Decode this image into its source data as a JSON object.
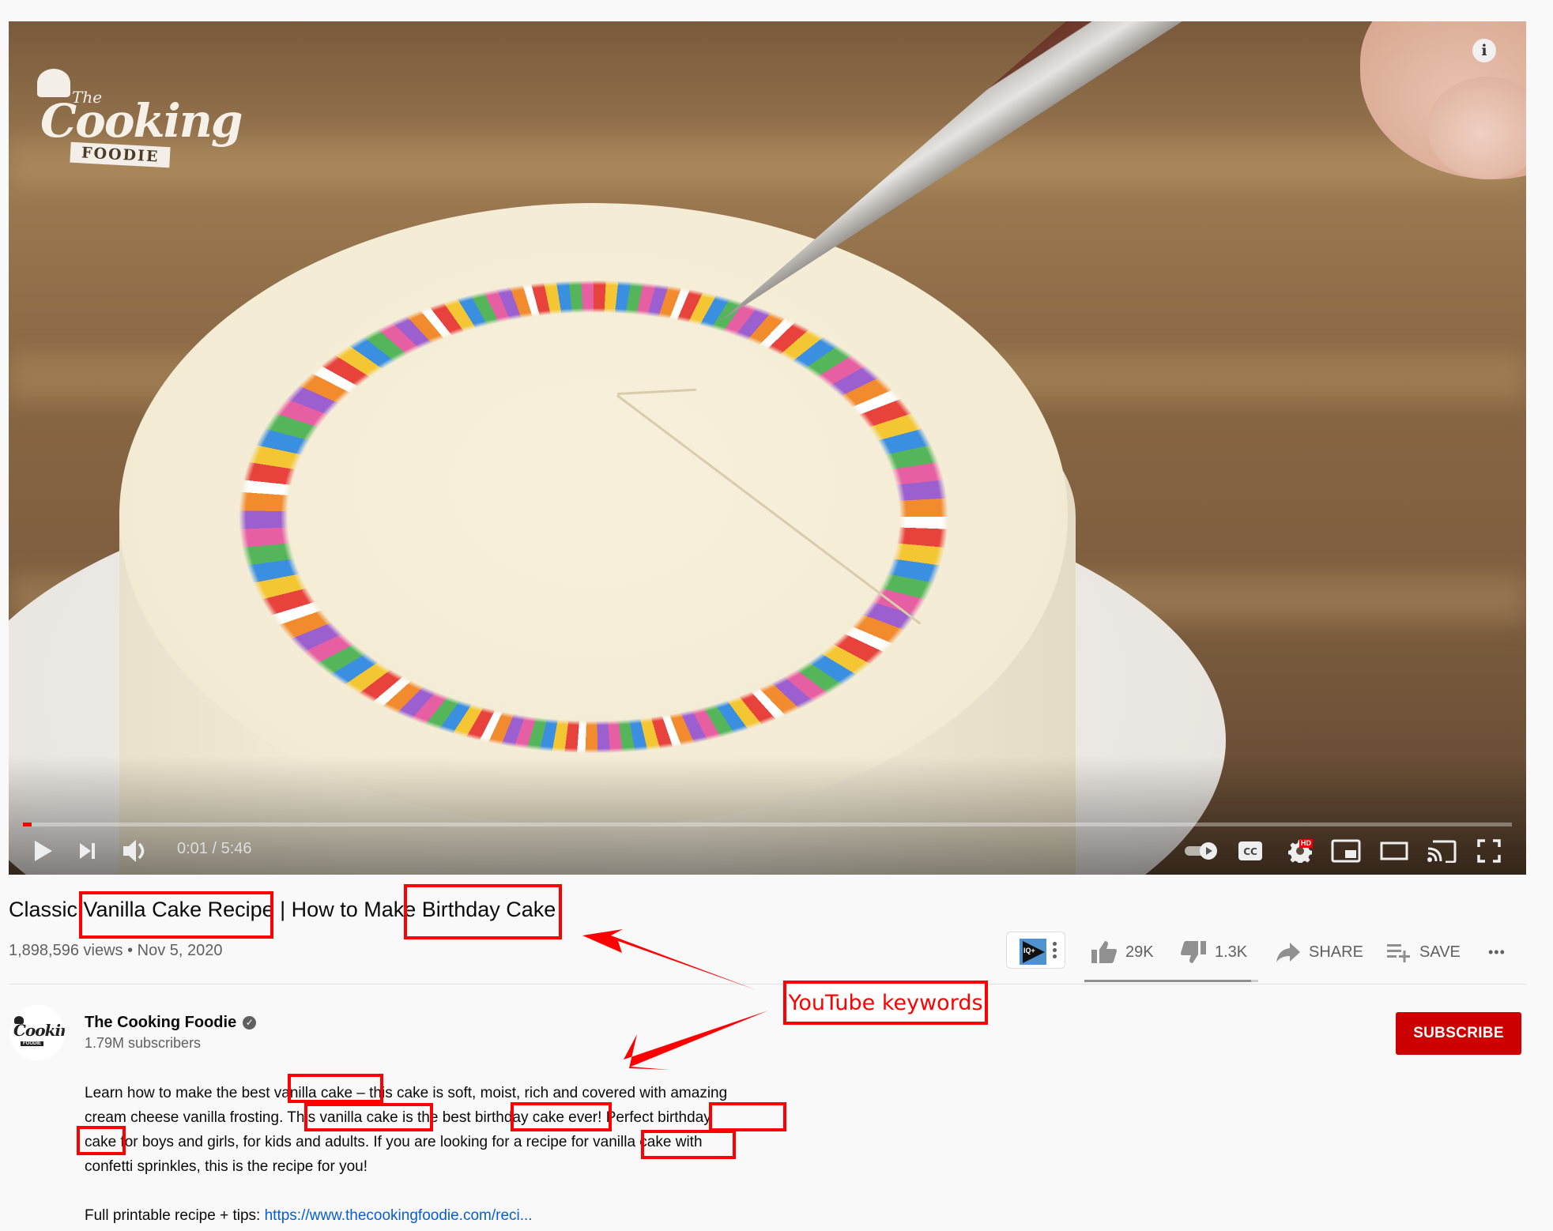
{
  "player": {
    "watermark": {
      "top": "The",
      "main": "Cooking",
      "banner": "FOODIE"
    },
    "info_icon": "info-icon",
    "progress_fraction": 0.003,
    "time_current": "0:01",
    "time_total": "5:46",
    "time_display": "0:01 / 5:46",
    "hd_badge": "HD",
    "cc_label": "CC",
    "controls": [
      "play-icon",
      "next-icon",
      "volume-icon",
      "autoplay-toggle",
      "captions-icon",
      "settings-icon",
      "miniplayer-icon",
      "theater-icon",
      "cast-icon",
      "fullscreen-icon"
    ]
  },
  "video": {
    "title_parts": [
      "Classic ",
      "Vanilla Cake Recipe",
      " | How to Make ",
      "Birthday Cake"
    ],
    "views": "1,898,596 views",
    "separator": "•",
    "date": "Nov 5, 2020",
    "views_line": "1,898,596 views • Nov 5, 2020"
  },
  "actions": {
    "extension_label": "IQ+",
    "likes": "29K",
    "dislikes": "1.3K",
    "share": "SHARE",
    "save": "SAVE",
    "more": "•••",
    "like_ratio": 0.957
  },
  "channel": {
    "name": "The Cooking Foodie",
    "verified_icon": "✓",
    "subscribers": "1.79M subscribers",
    "avatar_text": "Cooking",
    "avatar_band": "FOODIE",
    "subscribe_label": "SUBSCRIBE"
  },
  "description": {
    "lines": [
      "Learn how to make the best vanilla cake – this cake is soft, moist, rich and covered with amazing",
      "cream cheese vanilla frosting. This vanilla cake is the best birthday cake ever! Perfect birthday",
      "cake for boys and girls, for kids and adults. If you are looking for a recipe for vanilla cake with",
      "confetti sprinkles, this is the recipe for you!"
    ],
    "recipe_prefix": "Full printable recipe + tips: ",
    "recipe_link": "https://www.thecookingfoodie.com/reci..."
  },
  "annotation": {
    "label": "YouTube keywords",
    "color": "#ff0000",
    "highlighted_keywords": [
      "Vanilla Cake Recipe",
      "Birthday Cake",
      "vanilla cake",
      "This vanilla cake",
      "birthday cake",
      "birthday cake",
      "vanilla cake"
    ]
  },
  "colors": {
    "brand_red": "#cc0000",
    "progress_red": "#ff0000",
    "link_blue": "#065fd4",
    "secondary_text": "#606060",
    "background": "#f9f9f9"
  }
}
